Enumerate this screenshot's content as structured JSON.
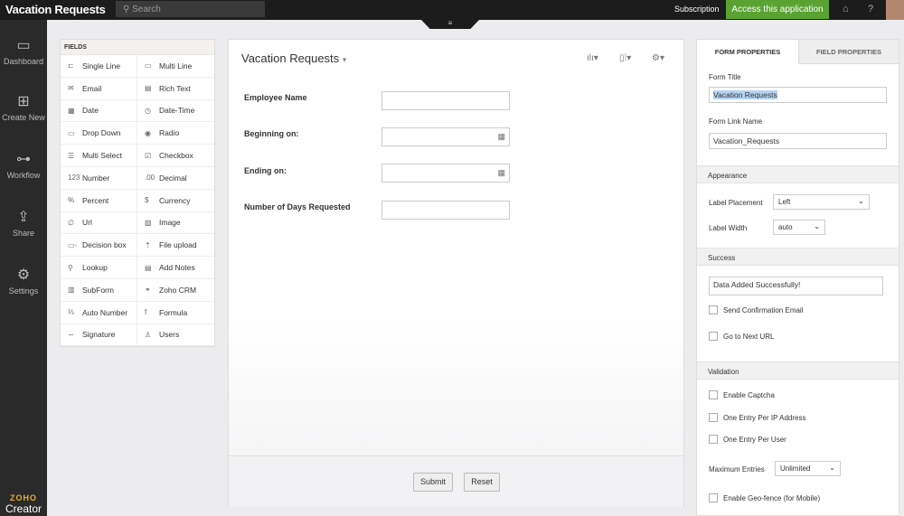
{
  "header": {
    "title": "Vacation Requests",
    "search_placeholder": "Search",
    "subscription": "Subscription",
    "access": "Access this application"
  },
  "nav": [
    {
      "label": "Dashboard",
      "icon": "monitor-icon"
    },
    {
      "label": "Create New",
      "icon": "plus-square-icon"
    },
    {
      "label": "Workflow",
      "icon": "workflow-icon"
    },
    {
      "label": "Share",
      "icon": "share-icon"
    },
    {
      "label": "Settings",
      "icon": "gear-icon"
    }
  ],
  "logo": {
    "top": "ZOHO",
    "bottom": "Creator"
  },
  "fields": {
    "title": "FIELDS",
    "items": [
      {
        "label": "Single Line",
        "icon": "⊏"
      },
      {
        "label": "Multi Line",
        "icon": "▭"
      },
      {
        "label": "Email",
        "icon": "✉"
      },
      {
        "label": "Rich Text",
        "icon": "▤"
      },
      {
        "label": "Date",
        "icon": "▦"
      },
      {
        "label": "Date-Time",
        "icon": "◷"
      },
      {
        "label": "Drop Down",
        "icon": "▭"
      },
      {
        "label": "Radio",
        "icon": "◉"
      },
      {
        "label": "Multi Select",
        "icon": "☰"
      },
      {
        "label": "Checkbox",
        "icon": "☑"
      },
      {
        "label": "Number",
        "icon": "123"
      },
      {
        "label": "Decimal",
        "icon": ".00"
      },
      {
        "label": "Percent",
        "icon": "%"
      },
      {
        "label": "Currency",
        "icon": "$"
      },
      {
        "label": "Url",
        "icon": "∅"
      },
      {
        "label": "Image",
        "icon": "▨"
      },
      {
        "label": "Decision box",
        "icon": "▭-"
      },
      {
        "label": "File upload",
        "icon": "⇡"
      },
      {
        "label": "Lookup",
        "icon": "⚲"
      },
      {
        "label": "Add Notes",
        "icon": "▤"
      },
      {
        "label": "SubForm",
        "icon": "▥"
      },
      {
        "label": "Zoho CRM",
        "icon": "⚭"
      },
      {
        "label": "Auto Number",
        "icon": "⅓"
      },
      {
        "label": "Formula",
        "icon": "f"
      },
      {
        "label": "Signature",
        "icon": "∽"
      },
      {
        "label": "Users",
        "icon": "♙"
      }
    ]
  },
  "form": {
    "title": "Vacation Requests",
    "fields": [
      "Employee Name",
      "Beginning on:",
      "Ending on:",
      "Number of Days Requested"
    ],
    "submit": "Submit",
    "reset": "Reset"
  },
  "props": {
    "tab1": "FORM PROPERTIES",
    "tab2": "FIELD PROPERTIES",
    "form_title_label": "Form Title",
    "form_title": "Vacation Requests",
    "link_label": "Form Link Name",
    "link": "Vacation_Requests",
    "appearance": "Appearance",
    "placement_label": "Label Placement",
    "placement": "Left",
    "width_label": "Label Width",
    "width": "auto",
    "success": "Success",
    "success_msg": "Data Added Successfully!",
    "send_email": "Send Confirmation Email",
    "next_url": "Go to Next URL",
    "validation": "Validation",
    "captcha": "Enable Captcha",
    "per_ip": "One Entry Per IP Address",
    "per_user": "One Entry Per User",
    "max_label": "Maximum Entries",
    "max": "Unlimited",
    "geofence": "Enable Geo-fence (for Mobile)"
  }
}
